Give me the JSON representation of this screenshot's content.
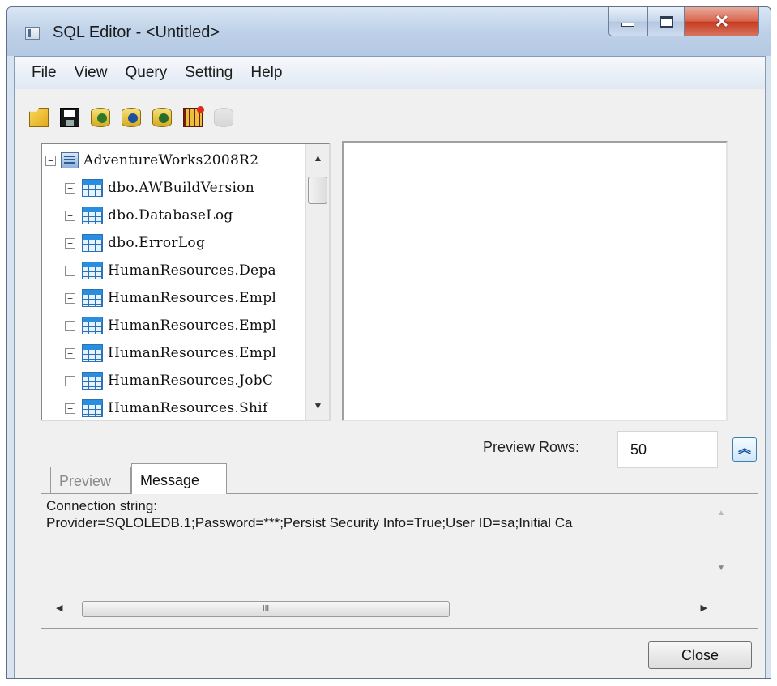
{
  "window": {
    "title": "SQL Editor - <Untitled>",
    "controls": {
      "minimize": "minimize",
      "maximize": "maximize",
      "close_glyph": "✕"
    }
  },
  "menubar": {
    "items": [
      "File",
      "View",
      "Query",
      "Setting",
      "Help"
    ]
  },
  "toolbar": {
    "buttons": [
      {
        "name": "open-folder-icon",
        "enabled": true
      },
      {
        "name": "save-icon",
        "enabled": true
      },
      {
        "name": "database-run-icon",
        "enabled": true
      },
      {
        "name": "database-connect-icon",
        "enabled": true
      },
      {
        "name": "database-refresh-icon",
        "enabled": true
      },
      {
        "name": "table-add-icon",
        "enabled": true
      },
      {
        "name": "database-disabled-icon",
        "enabled": false
      }
    ]
  },
  "tree": {
    "root": {
      "label": "AdventureWorks2008R2",
      "expander": "−"
    },
    "items": [
      {
        "label": "dbo.AWBuildVersion",
        "expander": "+"
      },
      {
        "label": "dbo.DatabaseLog",
        "expander": "+"
      },
      {
        "label": "dbo.ErrorLog",
        "expander": "+"
      },
      {
        "label": "HumanResources.Depa",
        "expander": "+"
      },
      {
        "label": "HumanResources.Empl",
        "expander": "+"
      },
      {
        "label": "HumanResources.Empl",
        "expander": "+"
      },
      {
        "label": "HumanResources.Empl",
        "expander": "+"
      },
      {
        "label": "HumanResources.JobC",
        "expander": "+"
      },
      {
        "label": "HumanResources.Shif",
        "expander": "+"
      }
    ]
  },
  "preview": {
    "label": "Preview Rows:",
    "value": "50",
    "toggle_glyph": "≈"
  },
  "tabs": {
    "preview": "Preview",
    "message": "Message"
  },
  "messages": {
    "line1": "Connection string:",
    "line2": "Provider=SQLOLEDB.1;Password=***;Persist Security Info=True;User ID=sa;Initial Ca"
  },
  "scroll": {
    "thumb_grip": "III"
  },
  "buttons": {
    "close": "Close"
  }
}
